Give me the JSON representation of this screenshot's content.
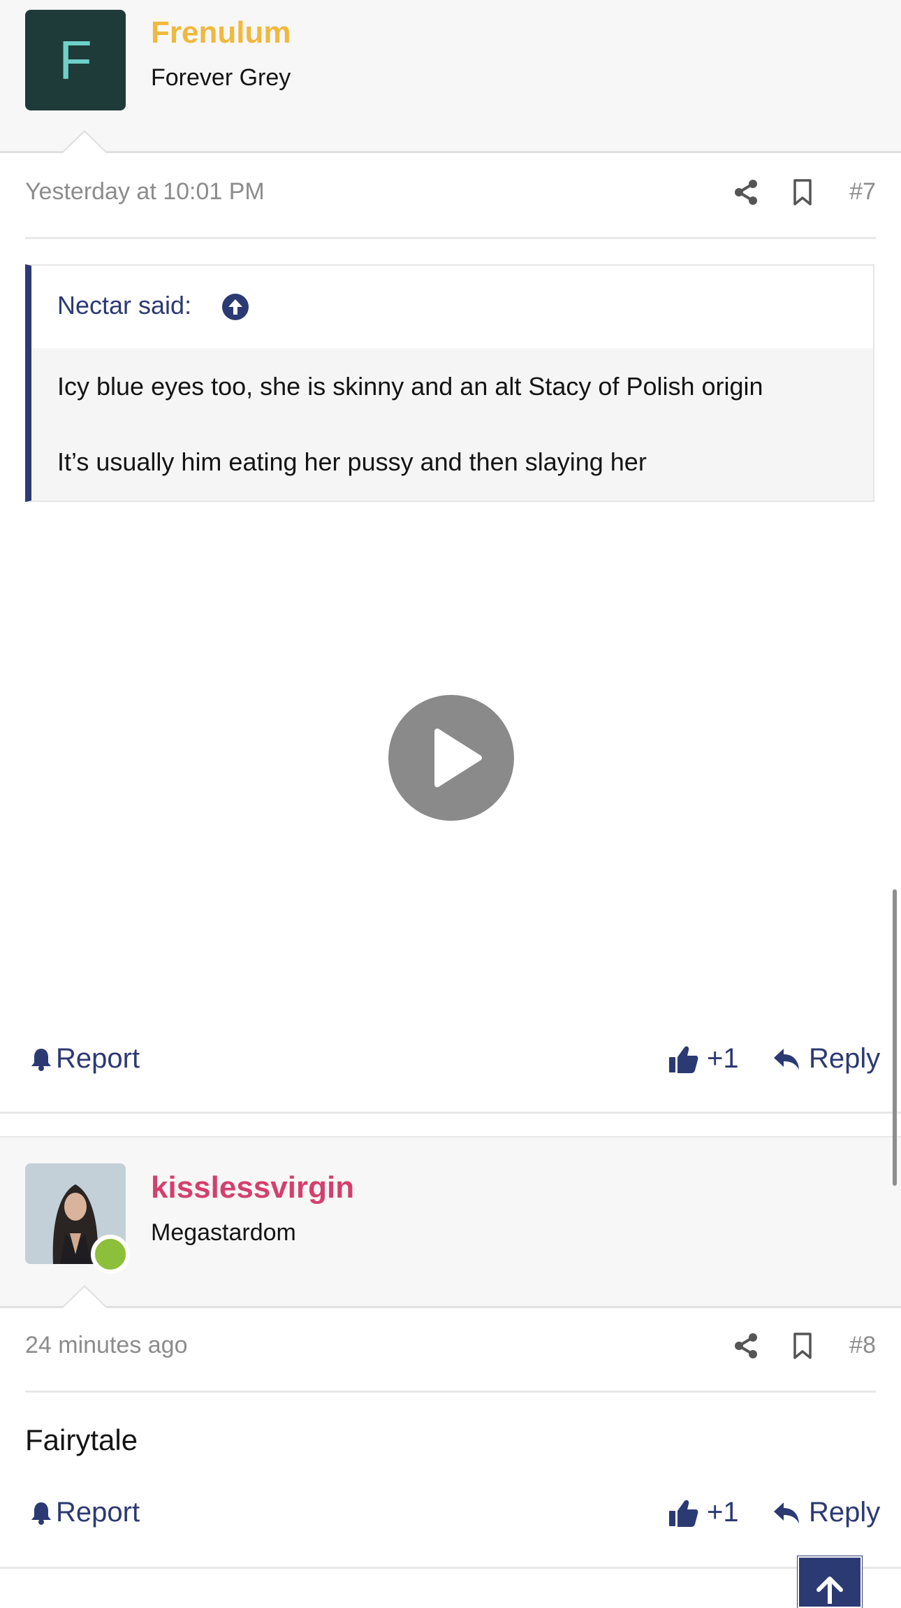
{
  "posts": [
    {
      "username": "Frenulum",
      "username_color": "#f0b83e",
      "avatar_letter": "F",
      "user_title": "Forever Grey",
      "date": "Yesterday at 10:01 PM",
      "post_number": "#7",
      "quote": {
        "attribution": "Nectar said:",
        "lines": [
          "Icy blue eyes too, she is skinny and an alt Stacy of Polish origin",
          "It’s usually him eating her pussy and then slaying her"
        ]
      },
      "actions": {
        "report": "Report",
        "like": "+1",
        "reply": "Reply"
      }
    },
    {
      "username": "kisslessvirgin",
      "username_color": "#d43f6e",
      "user_title": "Megastardom",
      "online": true,
      "date": "24 minutes ago",
      "post_number": "#8",
      "body": "Fairytale",
      "actions": {
        "report": "Report",
        "like": "+1",
        "reply": "Reply"
      }
    }
  ],
  "colors": {
    "accent": "#2c3a73",
    "muted_text": "#8c8c8c",
    "user_bar_bg": "#f7f7f7"
  },
  "icons": [
    "share-icon",
    "bookmark-icon",
    "arrow-up-circle-icon",
    "play-icon",
    "bell-icon",
    "thumbs-up-icon",
    "reply-icon",
    "arrow-up-icon"
  ]
}
